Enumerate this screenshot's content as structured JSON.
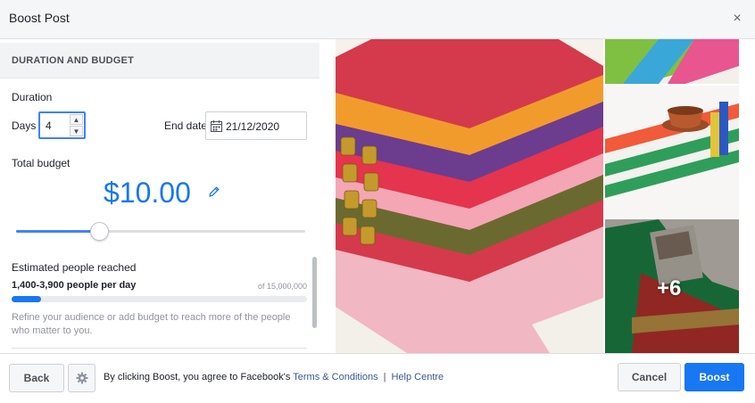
{
  "dialog": {
    "title": "Boost Post",
    "close_label": "×"
  },
  "duration_budget": {
    "section_title": "DURATION AND BUDGET",
    "duration_label": "Duration",
    "days_label": "Days",
    "days_value": "4",
    "end_date_label": "End date",
    "end_date_value": "21/12/2020",
    "total_budget_label": "Total budget",
    "budget_amount": "$10.00",
    "budget_slider_fraction": 0.29
  },
  "reach": {
    "title": "Estimated people reached",
    "range": "1,400-3,900 people per day",
    "of_total": "of 15,000,000",
    "fill_fraction": 0.1,
    "note": "Refine your audience or add budget to reach more of the people who matter to you."
  },
  "gallery": {
    "more_count": "+6"
  },
  "footer": {
    "back_label": "Back",
    "agree_prefix": "By clicking Boost, you agree to Facebook's",
    "terms_link": "Terms & Conditions",
    "separator": "|",
    "help_link": "Help Centre",
    "cancel_label": "Cancel",
    "boost_label": "Boost"
  },
  "icons": {
    "close": "close-icon",
    "calendar": "calendar-icon",
    "pencil": "pencil-icon",
    "gear": "gear-icon",
    "spinner_up": "chevron-up-icon",
    "spinner_down": "chevron-down-icon"
  },
  "colors": {
    "accent": "#1877f2",
    "slider": "#4080ff",
    "link": "#385898"
  }
}
